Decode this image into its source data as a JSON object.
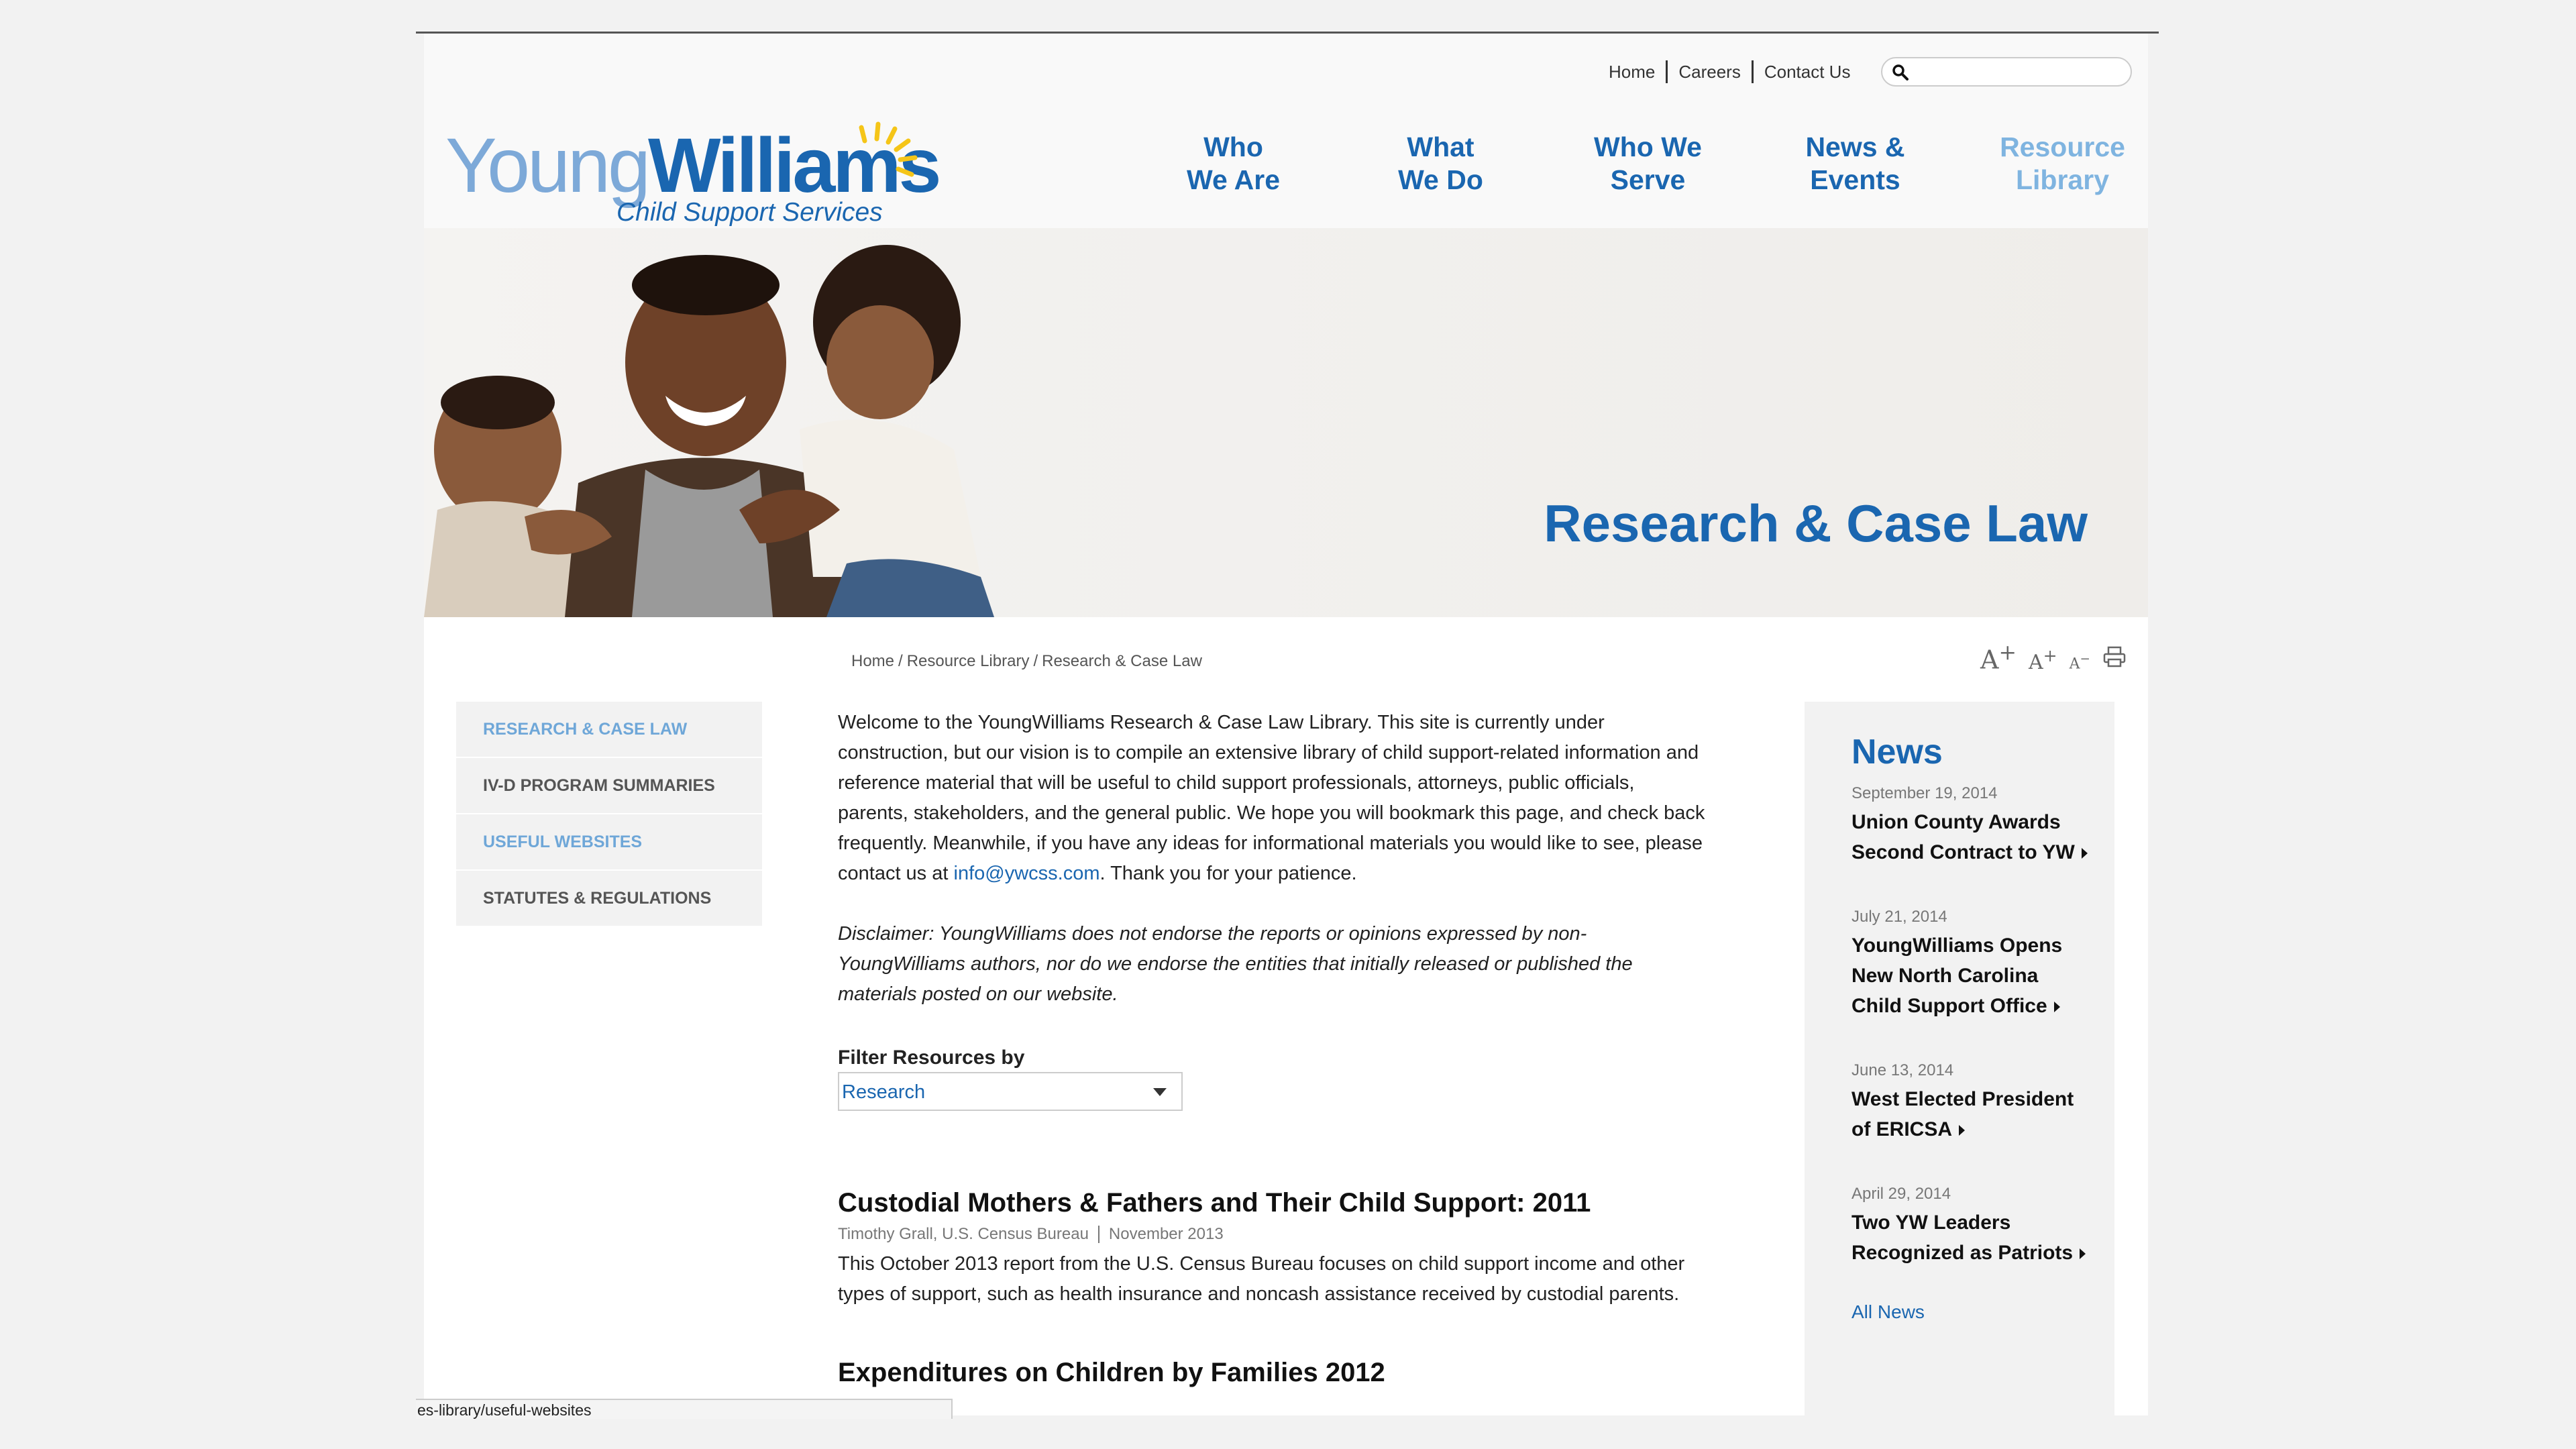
{
  "logo": {
    "young": "Young",
    "williams": "Williams",
    "subtitle": "Child Support Services"
  },
  "util_nav": [
    "Home",
    "Careers",
    "Contact Us"
  ],
  "search": {
    "placeholder": ""
  },
  "main_nav": [
    {
      "line1": "Who",
      "line2": "We Are"
    },
    {
      "line1": "What",
      "line2": "We Do"
    },
    {
      "line1": "Who We",
      "line2": "Serve"
    },
    {
      "line1": "News &",
      "line2": "Events"
    },
    {
      "line1": "Resource",
      "line2": "Library"
    }
  ],
  "hero": {
    "title": "Research & Case Law"
  },
  "breadcrumb": [
    "Home",
    "Resource Library",
    "Research & Case Law"
  ],
  "text_tools": {
    "large": "A",
    "medium": "A",
    "small": "A"
  },
  "side_nav": [
    "RESEARCH & CASE LAW",
    "IV-D PROGRAM SUMMARIES",
    "USEFUL WEBSITES",
    "STATUTES & REGULATIONS"
  ],
  "content": {
    "intro_before": "Welcome to the YoungWilliams Research & Case Law Library.  This site is currently under construction, but our vision is to compile an extensive library of child support-related information and reference material that will be useful to child support professionals, attorneys, public officials, parents, stakeholders, and the general public.  We hope you will bookmark this page, and check back frequently.  Meanwhile, if you have any ideas for informational materials you would like to see, please contact us at ",
    "email": "info@ywcss.com",
    "intro_after": ".  Thank you for your patience.",
    "disclaimer": "Disclaimer:  YoungWilliams does not endorse the reports or opinions expressed by non-YoungWilliams authors, nor do we endorse the entities that initially released or published the materials posted on our website.",
    "filter_label": "Filter Resources by",
    "filter_value": "Research"
  },
  "articles": [
    {
      "title": "Custodial Mothers & Fathers and Their Child Support: 2011",
      "author": "Timothy Grall, U.S. Census Bureau",
      "date": "November 2013",
      "desc": "This October 2013 report from the U.S. Census Bureau  focuses on child support income and other types of support, such as health insurance and noncash assistance received by custodial parents."
    },
    {
      "title": "Expenditures on Children by Families 2012"
    }
  ],
  "news": {
    "heading": "News",
    "items": [
      {
        "date": "September 19, 2014",
        "title": "Union County Awards Second Contract to YW"
      },
      {
        "date": "July 21, 2014",
        "title": "YoungWilliams Opens New North Carolina Child Support Office"
      },
      {
        "date": "June 13, 2014",
        "title": "West Elected President of ERICSA"
      },
      {
        "date": "April 29, 2014",
        "title": "Two YW Leaders Recognized as Patriots"
      }
    ],
    "all_news": "All News"
  },
  "status_bar": "es-library/useful-websites",
  "colors": {
    "brand_blue": "#1a66b0",
    "light_blue": "#7fb4e0",
    "sun_yellow": "#f5c518"
  }
}
